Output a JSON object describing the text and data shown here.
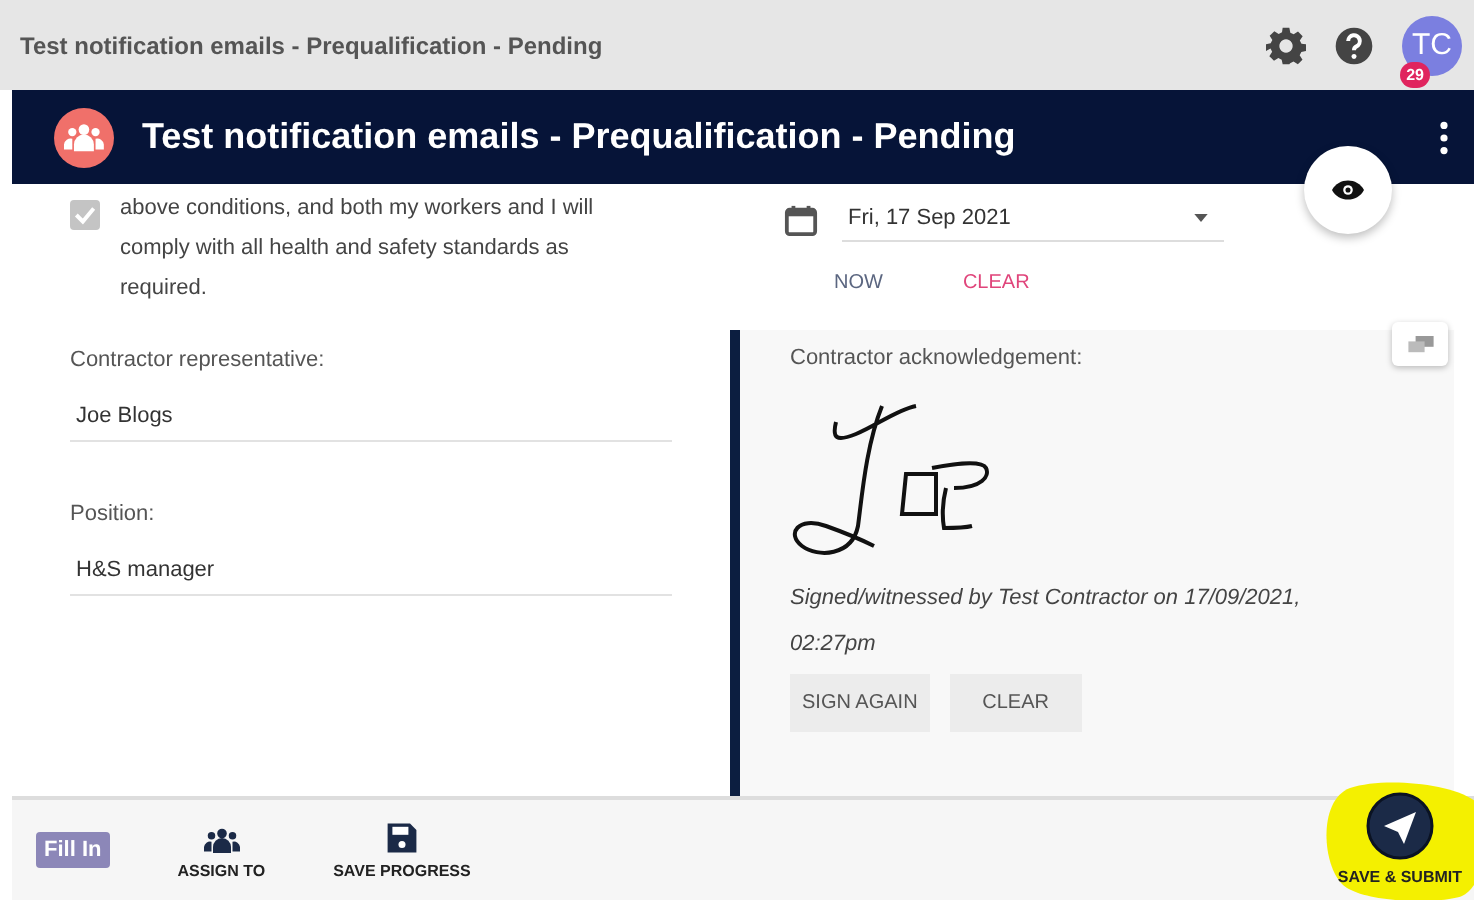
{
  "top_bar": {
    "title": "Test notification emails - Prequalification - Pending",
    "avatar": "TC",
    "badge": "29"
  },
  "header": {
    "title": "Test notification emails - Prequalification - Pending"
  },
  "declaration": {
    "text": "above conditions, and both my workers and I will comply with all health and safety standards as required.",
    "checked": true
  },
  "fields": [
    {
      "label": "Contractor representative:",
      "value": "Joe Blogs"
    },
    {
      "label": "Position:",
      "value": "H&S manager"
    }
  ],
  "date": {
    "value": "Fri, 17 Sep 2021"
  },
  "date_actions": [
    {
      "label": "NOW",
      "kind": "neutral"
    },
    {
      "label": "CLEAR",
      "kind": "danger"
    }
  ],
  "acknowledgement": {
    "label": "Contractor acknowledgement:",
    "signed_text": "Signed/witnessed by Test Contractor on 17/09/2021, 02:27pm",
    "buttons": [
      "SIGN AGAIN",
      "CLEAR"
    ]
  },
  "toolbar": {
    "status": "Fill In",
    "actions": [
      {
        "label": "ASSIGN TO",
        "kind": "people"
      },
      {
        "label": "SAVE PROGRESS",
        "kind": "save"
      }
    ],
    "submit": {
      "label": "SAVE & SUBMIT",
      "highlighted": true
    }
  }
}
